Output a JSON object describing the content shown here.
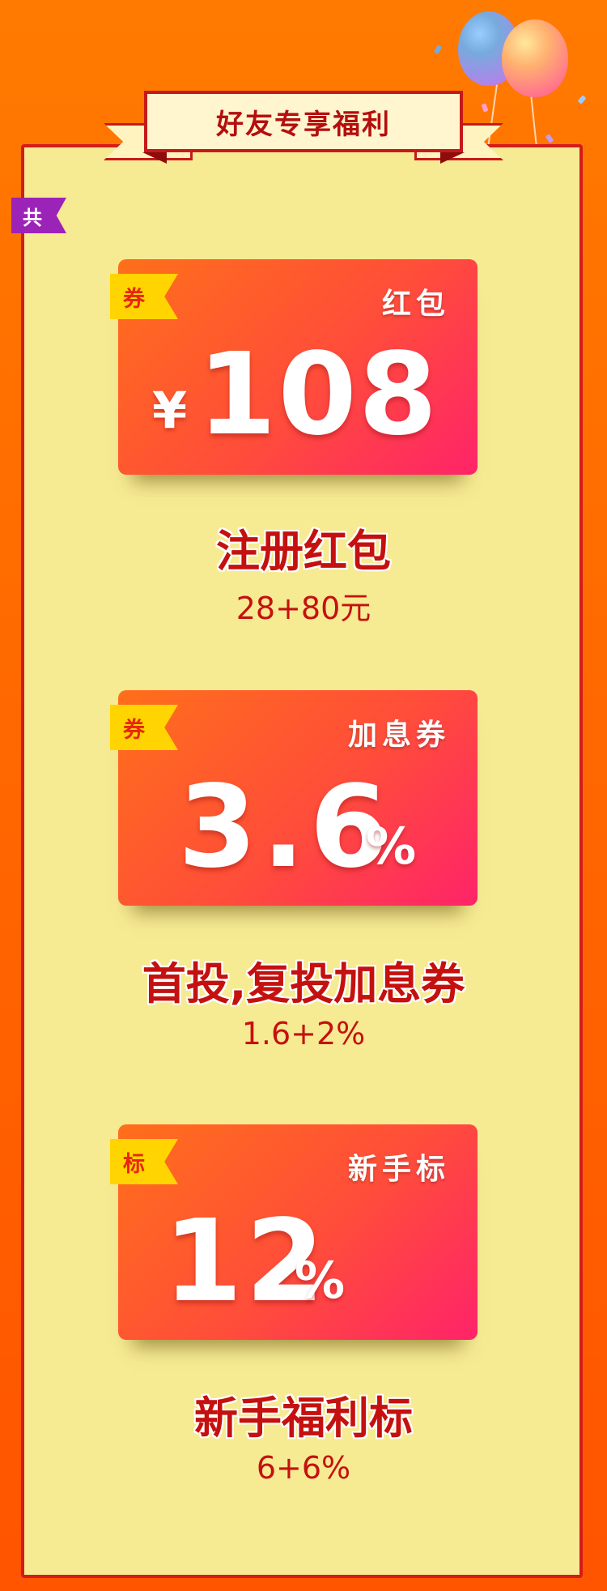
{
  "header": {
    "title": "好友专享福利"
  },
  "side_tag": {
    "label": "共"
  },
  "cards": [
    {
      "tag": "券",
      "type": "红包",
      "currency": "¥",
      "value": "108",
      "unit": "",
      "title": "注册红包",
      "detail": "28+80元"
    },
    {
      "tag": "券",
      "type": "加息券",
      "currency": "",
      "value": "3.6",
      "unit": "%",
      "title": "首投,复投加息券",
      "detail": "1.6+2%"
    },
    {
      "tag": "标",
      "type": "新手标",
      "currency": "",
      "value": "12",
      "unit": "%",
      "title": "新手福利标",
      "detail": "6+6%"
    }
  ],
  "colors": {
    "background": "#ff6a00",
    "panel": "#f6ea93",
    "border": "#d31c1c",
    "card_start": "#ff6f1a",
    "card_end": "#ff2369",
    "tag": "#ffd400",
    "side_tag": "#9b23b8",
    "text_red": "#c4110f"
  }
}
